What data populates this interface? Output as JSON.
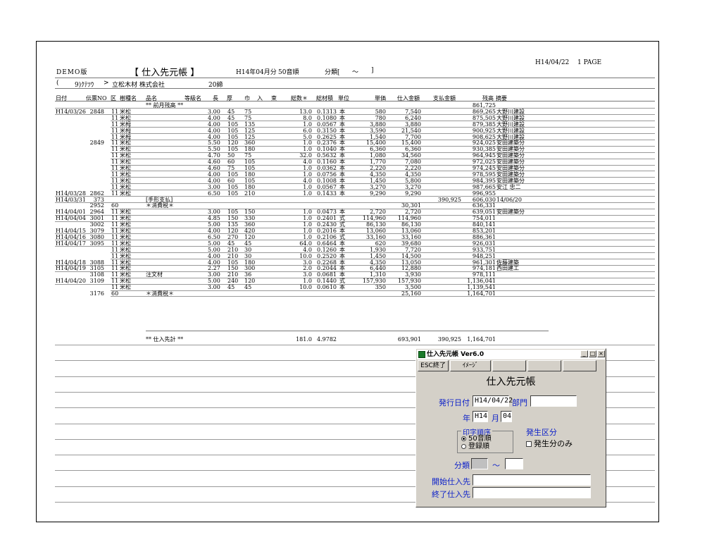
{
  "report": {
    "demo_label": "DEMO版",
    "title": "【 仕入先元帳 】",
    "period": "H14年04月分",
    "sort": "50音順",
    "bunrui": "分類[",
    "bunrui_tilde": "〜",
    "bunrui_close": "]",
    "date": "H14/04/22",
    "page": "1 PAGE",
    "supplier_open": "(",
    "supplier_code": "9)ｸﾃﾂｳ",
    "supplier_arrow": ">",
    "supplier_name": "立松木材 株式会社",
    "cutoff": "20締"
  },
  "columns": [
    "日付",
    "伝票NO",
    "区",
    "樹種名",
    "品名",
    "等級名",
    "長",
    "厚",
    "巾",
    "入",
    "束",
    "総数＊",
    "総材積",
    "単位",
    "単価",
    "仕入金額",
    "支払金額",
    "残高",
    "摘要"
  ],
  "rows": [
    {
      "date": "",
      "no": "",
      "ku": "",
      "species": "",
      "item": "** 前月残高 **",
      "len": "",
      "th": "",
      "wd": "",
      "qty": "",
      "vol": "",
      "unit": "",
      "price": "",
      "amount": "",
      "pay": "",
      "bal": "861,725",
      "memo": ""
    },
    {
      "date": "H14/03/26",
      "no": "2848",
      "ku": "11",
      "species": "米松",
      "item": "",
      "len": "3.00",
      "th": "45",
      "wd": "75",
      "qty": "13.0",
      "vol": "0.1313",
      "unit": "本",
      "price": "580",
      "amount": "7,540",
      "pay": "",
      "bal": "869,265",
      "memo": "大野川建設"
    },
    {
      "date": "",
      "no": "",
      "ku": "11",
      "species": "米松",
      "item": "",
      "len": "4.00",
      "th": "45",
      "wd": "75",
      "qty": "8.0",
      "vol": "0.1080",
      "unit": "本",
      "price": "780",
      "amount": "6,240",
      "pay": "",
      "bal": "875,505",
      "memo": "大野川建設"
    },
    {
      "date": "",
      "no": "",
      "ku": "11",
      "species": "米栂",
      "item": "",
      "len": "4.00",
      "th": "105",
      "wd": "135",
      "qty": "1.0",
      "vol": "0.0567",
      "unit": "本",
      "price": "3,880",
      "amount": "3,880",
      "pay": "",
      "bal": "879,385",
      "memo": "大野川建設"
    },
    {
      "date": "",
      "no": "",
      "ku": "11",
      "species": "米栂",
      "item": "",
      "len": "4.00",
      "th": "105",
      "wd": "125",
      "qty": "6.0",
      "vol": "0.3150",
      "unit": "本",
      "price": "3,590",
      "amount": "21,540",
      "pay": "",
      "bal": "900,925",
      "memo": "大野川建設"
    },
    {
      "date": "",
      "no": "",
      "ku": "11",
      "species": "米栂",
      "item": "",
      "len": "4.00",
      "th": "105",
      "wd": "125",
      "qty": "5.0",
      "vol": "0.2625",
      "unit": "本",
      "price": "1,540",
      "amount": "7,700",
      "pay": "",
      "bal": "908,625",
      "memo": "大野川建設"
    },
    {
      "date": "",
      "no": "2849",
      "ku": "11",
      "species": "米松",
      "item": "",
      "len": "5.50",
      "th": "120",
      "wd": "360",
      "qty": "1.0",
      "vol": "0.2376",
      "unit": "本",
      "price": "15,400",
      "amount": "15,400",
      "pay": "",
      "bal": "924,025",
      "memo": "安田建築分"
    },
    {
      "date": "",
      "no": "",
      "ku": "11",
      "species": "米松",
      "item": "",
      "len": "5.50",
      "th": "105",
      "wd": "180",
      "qty": "1.0",
      "vol": "0.1040",
      "unit": "本",
      "price": "6,360",
      "amount": "6,360",
      "pay": "",
      "bal": "930,385",
      "memo": "安田建築分"
    },
    {
      "date": "",
      "no": "",
      "ku": "11",
      "species": "米松",
      "item": "",
      "len": "4.70",
      "th": "50",
      "wd": "75",
      "qty": "32.0",
      "vol": "0.5632",
      "unit": "本",
      "price": "1,080",
      "amount": "34,560",
      "pay": "",
      "bal": "964,945",
      "memo": "安田建築分"
    },
    {
      "date": "",
      "no": "",
      "ku": "11",
      "species": "米松",
      "item": "",
      "len": "4.60",
      "th": "60",
      "wd": "105",
      "qty": "4.0",
      "vol": "0.1160",
      "unit": "本",
      "price": "1,770",
      "amount": "7,080",
      "pay": "",
      "bal": "972,025",
      "memo": "安田建築分"
    },
    {
      "date": "",
      "no": "",
      "ku": "11",
      "species": "米松",
      "item": "",
      "len": "4.60",
      "th": "75",
      "wd": "105",
      "qty": "1.0",
      "vol": "0.0362",
      "unit": "本",
      "price": "2,220",
      "amount": "2,220",
      "pay": "",
      "bal": "974,245",
      "memo": "安田建築分"
    },
    {
      "date": "",
      "no": "",
      "ku": "11",
      "species": "米松",
      "item": "",
      "len": "4.00",
      "th": "105",
      "wd": "180",
      "qty": "1.0",
      "vol": "0.0756",
      "unit": "本",
      "price": "4,350",
      "amount": "4,350",
      "pay": "",
      "bal": "978,595",
      "memo": "安田建築分"
    },
    {
      "date": "",
      "no": "",
      "ku": "11",
      "species": "米松",
      "item": "",
      "len": "4.00",
      "th": "60",
      "wd": "105",
      "qty": "4.0",
      "vol": "0.1008",
      "unit": "本",
      "price": "1,450",
      "amount": "5,800",
      "pay": "",
      "bal": "984,395",
      "memo": "安田建築分"
    },
    {
      "date": "",
      "no": "",
      "ku": "11",
      "species": "米松",
      "item": "",
      "len": "3.00",
      "th": "105",
      "wd": "180",
      "qty": "1.0",
      "vol": "0.0567",
      "unit": "本",
      "price": "3,270",
      "amount": "3,270",
      "pay": "",
      "bal": "987,665",
      "memo": "安江 忠二"
    },
    {
      "date": "H14/03/28",
      "no": "2862",
      "ku": "11",
      "species": "米松",
      "item": "",
      "len": "6.50",
      "th": "105",
      "wd": "210",
      "qty": "1.0",
      "vol": "0.1433",
      "unit": "本",
      "price": "9,290",
      "amount": "9,290",
      "pay": "",
      "bal": "996,955",
      "memo": ""
    },
    {
      "date": "H14/03/31",
      "no": "373",
      "ku": "",
      "species": "",
      "item": "[手形支払]",
      "len": "",
      "th": "",
      "wd": "",
      "qty": "",
      "vol": "",
      "unit": "",
      "price": "",
      "amount": "",
      "pay": "390,925",
      "bal": "606,030",
      "memo": "14/06/20"
    },
    {
      "date": "",
      "no": "2952",
      "ku": "60",
      "species": "",
      "item": "＊消費税＊",
      "len": "",
      "th": "",
      "wd": "",
      "qty": "",
      "vol": "",
      "unit": "",
      "price": "",
      "amount": "30,301",
      "pay": "",
      "bal": "636,331",
      "memo": ""
    },
    {
      "date": "H14/04/01",
      "no": "2964",
      "ku": "11",
      "species": "米松",
      "item": "",
      "len": "3.00",
      "th": "105",
      "wd": "150",
      "qty": "1.0",
      "vol": "0.0473",
      "unit": "本",
      "price": "2,720",
      "amount": "2,720",
      "pay": "",
      "bal": "639,051",
      "memo": "安田建築分"
    },
    {
      "date": "H14/04/04",
      "no": "3001",
      "ku": "11",
      "species": "米松",
      "item": "",
      "len": "4.85",
      "th": "150",
      "wd": "330",
      "qty": "1.0",
      "vol": "0.2401",
      "unit": "式",
      "price": "114,960",
      "amount": "114,960",
      "pay": "",
      "bal": "754,011",
      "memo": ""
    },
    {
      "date": "",
      "no": "3002",
      "ku": "11",
      "species": "米松",
      "item": "",
      "len": "5.00",
      "th": "135",
      "wd": "360",
      "qty": "1.0",
      "vol": "0.2430",
      "unit": "式",
      "price": "86,130",
      "amount": "86,130",
      "pay": "",
      "bal": "840,141",
      "memo": ""
    },
    {
      "date": "H14/04/15",
      "no": "3079",
      "ku": "11",
      "species": "米松",
      "item": "",
      "len": "4.00",
      "th": "120",
      "wd": "420",
      "qty": "1.0",
      "vol": "0.2016",
      "unit": "本",
      "price": "13,060",
      "amount": "13,060",
      "pay": "",
      "bal": "853,201",
      "memo": ""
    },
    {
      "date": "H14/04/16",
      "no": "3080",
      "ku": "11",
      "species": "米松",
      "item": "",
      "len": "6.50",
      "th": "270",
      "wd": "120",
      "qty": "1.0",
      "vol": "0.2106",
      "unit": "式",
      "price": "33,160",
      "amount": "33,160",
      "pay": "",
      "bal": "886,361",
      "memo": ""
    },
    {
      "date": "H14/04/17",
      "no": "3095",
      "ku": "11",
      "species": "米松",
      "item": "",
      "len": "5.00",
      "th": "45",
      "wd": "45",
      "qty": "64.0",
      "vol": "0.6464",
      "unit": "本",
      "price": "620",
      "amount": "39,680",
      "pay": "",
      "bal": "926,031",
      "memo": ""
    },
    {
      "date": "",
      "no": "",
      "ku": "11",
      "species": "米松",
      "item": "",
      "len": "5.00",
      "th": "210",
      "wd": "30",
      "qty": "4.0",
      "vol": "0.1260",
      "unit": "本",
      "price": "1,930",
      "amount": "7,720",
      "pay": "",
      "bal": "933,751",
      "memo": ""
    },
    {
      "date": "",
      "no": "",
      "ku": "11",
      "species": "米松",
      "item": "",
      "len": "4.00",
      "th": "210",
      "wd": "30",
      "qty": "10.0",
      "vol": "0.2520",
      "unit": "本",
      "price": "1,450",
      "amount": "14,500",
      "pay": "",
      "bal": "948,251",
      "memo": ""
    },
    {
      "date": "H14/04/18",
      "no": "3088",
      "ku": "11",
      "species": "米松",
      "item": "",
      "len": "4.00",
      "th": "105",
      "wd": "180",
      "qty": "3.0",
      "vol": "0.2268",
      "unit": "本",
      "price": "4,350",
      "amount": "13,050",
      "pay": "",
      "bal": "961,301",
      "memo": "佐藤建築"
    },
    {
      "date": "H14/04/19",
      "no": "3105",
      "ku": "11",
      "species": "米松",
      "item": "",
      "len": "2.27",
      "th": "150",
      "wd": "300",
      "qty": "2.0",
      "vol": "0.2044",
      "unit": "本",
      "price": "6,440",
      "amount": "12,880",
      "pay": "",
      "bal": "974,181",
      "memo": "西田建工"
    },
    {
      "date": "",
      "no": "3108",
      "ku": "11",
      "species": "米松",
      "item": "注文材",
      "len": "3.00",
      "th": "210",
      "wd": "36",
      "qty": "3.0",
      "vol": "0.0681",
      "unit": "本",
      "price": "1,310",
      "amount": "3,930",
      "pay": "",
      "bal": "978,111",
      "memo": ""
    },
    {
      "date": "H14/04/20",
      "no": "3109",
      "ku": "11",
      "species": "米松",
      "item": "",
      "len": "5.00",
      "th": "240",
      "wd": "120",
      "qty": "1.0",
      "vol": "0.1440",
      "unit": "式",
      "price": "157,930",
      "amount": "157,930",
      "pay": "",
      "bal": "1,136,041",
      "memo": ""
    },
    {
      "date": "",
      "no": "",
      "ku": "11",
      "species": "米松",
      "item": "",
      "len": "3.00",
      "th": "45",
      "wd": "45",
      "qty": "10.0",
      "vol": "0.0610",
      "unit": "本",
      "price": "350",
      "amount": "3,500",
      "pay": "",
      "bal": "1,139,541",
      "memo": ""
    },
    {
      "date": "",
      "no": "3176",
      "ku": "60",
      "species": "",
      "item": "＊消費税＊",
      "len": "",
      "th": "",
      "wd": "",
      "qty": "",
      "vol": "",
      "unit": "",
      "price": "",
      "amount": "25,160",
      "pay": "",
      "bal": "1,164,701",
      "memo": ""
    }
  ],
  "totals": {
    "label": "** 仕入先計 **",
    "qty": "181.0",
    "vol": "4.9782",
    "amount": "693,901",
    "pay": "390,925",
    "bal": "1,164,701"
  },
  "dialog": {
    "title": "仕入先元帳 Ver6.0",
    "minimize": "_",
    "maximize": "□",
    "close": "×",
    "esc_button": "ESC終了",
    "image_button": "ｲﾒｰｼﾞ",
    "heading": "仕入先元帳",
    "issue_date_label": "発行日付",
    "issue_date": "H14/04/22",
    "dept_label": "部門",
    "dept_value": "",
    "year_label": "年",
    "year": "H14",
    "month_label": "月",
    "month": "04",
    "order_label": "印字順序",
    "order_options": [
      "50音順",
      "登録順"
    ],
    "order_selected": 0,
    "occur_label": "発生区分",
    "occur_only_label": "発生分のみ",
    "occur_only_checked": false,
    "bunrui_label": "分類",
    "bunrui_from": "",
    "tilde": "〜",
    "bunrui_to": "",
    "start_label": "開始仕入先",
    "start_value": "",
    "end_label": "終了仕入先",
    "end_value": ""
  }
}
